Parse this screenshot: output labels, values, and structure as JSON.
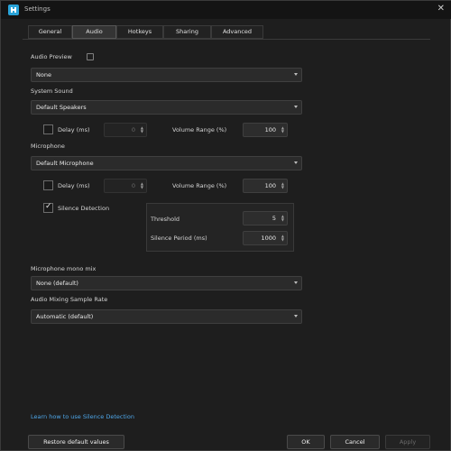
{
  "window": {
    "title": "Settings",
    "close": "✕"
  },
  "tabs": [
    "General",
    "Audio",
    "Hotkeys",
    "Sharing",
    "Advanced"
  ],
  "audio_preview": {
    "label": "Audio Preview",
    "value": "None"
  },
  "system_sound": {
    "label": "System Sound",
    "device": "Default Speakers",
    "delay_label": "Delay (ms)",
    "delay_value": "0",
    "volume_label": "Volume Range (%)",
    "volume_value": "100"
  },
  "microphone": {
    "label": "Microphone",
    "device": "Default Microphone",
    "delay_label": "Delay (ms)",
    "delay_value": "0",
    "volume_label": "Volume Range (%)",
    "volume_value": "100",
    "silence_label": "Silence Detection",
    "threshold_label": "Threshold",
    "threshold_value": "5",
    "silence_period_label": "Silence Period (ms)",
    "silence_period_value": "1000"
  },
  "mono_mix": {
    "label": "Microphone mono mix",
    "value": "None (default)"
  },
  "sample_rate": {
    "label": "Audio Mixing Sample Rate",
    "value": "Automatic (default)"
  },
  "footer": {
    "link": "Learn how to use Silence Detection",
    "restore": "Restore default values",
    "ok": "OK",
    "cancel": "Cancel",
    "apply": "Apply"
  },
  "colors": {
    "accent": "#29a3d8",
    "link": "#4ea6e8"
  }
}
